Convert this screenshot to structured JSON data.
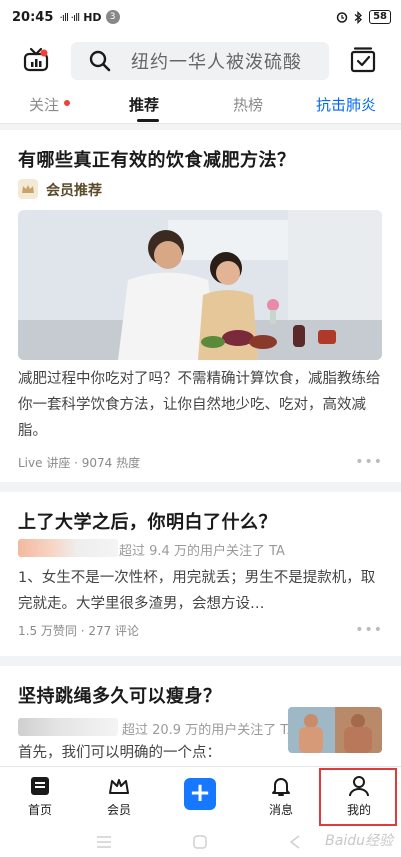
{
  "status_bar": {
    "time": "20:45",
    "signal": "·ıll ·ıll",
    "network": "HD",
    "notification_count": "3",
    "battery": "58"
  },
  "header": {
    "search_text": "纽约一华人被泼硫酸"
  },
  "tabs": [
    {
      "label": "关注",
      "active": false,
      "has_dot": true
    },
    {
      "label": "推荐",
      "active": true
    },
    {
      "label": "热榜",
      "active": false
    },
    {
      "label": "抗击肺炎",
      "active": false,
      "accent": "#0066ff"
    }
  ],
  "feed": [
    {
      "title": "有哪些真正有效的饮食减肥方法？",
      "tag": "会员推荐",
      "excerpt": "减肥过程中你吃对了吗？不需精确计算饮食，减脂教练给你一套科学饮食方法，让你自然地少吃、吃对，高效减脂。",
      "meta": "Live 讲座 · 9074 热度"
    },
    {
      "title": "上了大学之后，你明白了什么？",
      "follower_text": "超过 9.4 万的用户关注了 TA",
      "excerpt": "1、女生不是一次性杯，用完就丢；男生不是提款机，取完就走。大学里很多渣男，会想方设…",
      "meta": "1.5 万赞同 · 277 评论"
    },
    {
      "title": "坚持跳绳多久可以瘦身？",
      "follower_text": "超过 20.9 万的用户关注了 TA",
      "excerpt": "首先，我们可以明确的一个点："
    }
  ],
  "bottom_nav": [
    {
      "label": "首页",
      "icon": "home-icon"
    },
    {
      "label": "会员",
      "icon": "crown-icon"
    },
    {
      "label": "+",
      "icon": "plus-icon"
    },
    {
      "label": "消息",
      "icon": "bell-icon"
    },
    {
      "label": "我的",
      "icon": "person-icon"
    }
  ],
  "watermark": "Baidu经验",
  "colors": {
    "accent_blue": "#1677ff",
    "red_dot": "#f1403c",
    "highlight": "#e03a3a"
  }
}
